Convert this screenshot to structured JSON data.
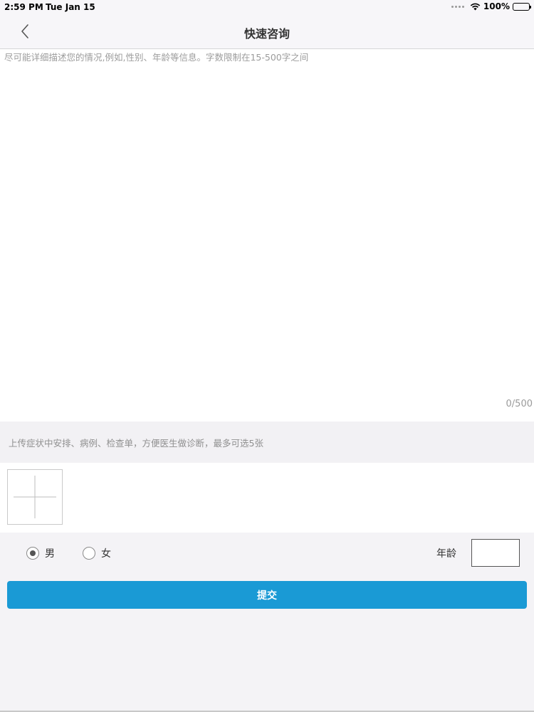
{
  "status_bar": {
    "time": "2:59 PM",
    "date": "Tue Jan 15",
    "battery": "100%"
  },
  "header": {
    "title": "快速咨询",
    "back_icon": "chevron-left-icon"
  },
  "description": {
    "placeholder": "尽可能详细描述您的情况,例如,性别、年龄等信息。字数限制在15-500字之间",
    "value": "",
    "char_count": "0/500"
  },
  "upload": {
    "hint": "上传症状中安排、病例、检查单，方便医生做诊断，最多可选5张",
    "add_icon": "plus-icon"
  },
  "gender": {
    "options": [
      {
        "label": "男",
        "selected": true
      },
      {
        "label": "女",
        "selected": false
      }
    ]
  },
  "age": {
    "label": "年龄",
    "value": ""
  },
  "submit": {
    "label": "提交"
  },
  "colors": {
    "accent": "#1a9ad5",
    "background": "#f4f3f6"
  }
}
